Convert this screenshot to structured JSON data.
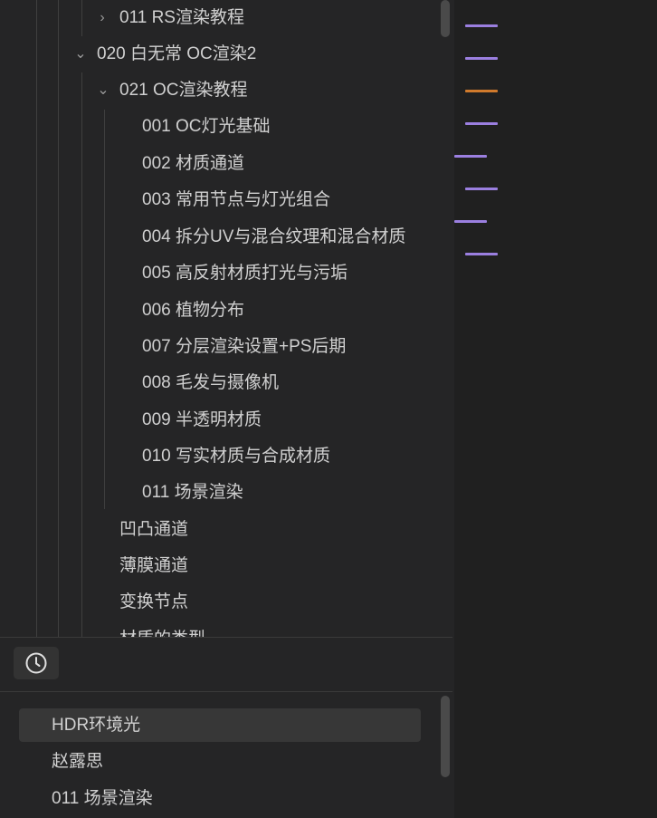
{
  "tree": [
    {
      "label": "011  RS渲染教程",
      "chevron": "›"
    },
    {
      "label": "020 白无常 OC渲染2",
      "chevron": "⌄"
    },
    {
      "label": "021 OC渲染教程",
      "chevron": "⌄"
    },
    {
      "label": "001 OC灯光基础"
    },
    {
      "label": "002 材质通道"
    },
    {
      "label": "003 常用节点与灯光组合"
    },
    {
      "label": "004 拆分UV与混合纹理和混合材质"
    },
    {
      "label": "005 高反射材质打光与污垢"
    },
    {
      "label": "006 植物分布"
    },
    {
      "label": "007 分层渲染设置+PS后期"
    },
    {
      "label": "008 毛发与摄像机"
    },
    {
      "label": "009 半透明材质"
    },
    {
      "label": "010 写实材质与合成材质"
    },
    {
      "label": "011 场景渲染"
    },
    {
      "label": "凹凸通道"
    },
    {
      "label": "薄膜通道"
    },
    {
      "label": "变换节点"
    },
    {
      "label": "材质的类型"
    }
  ],
  "history": {
    "icon": "clock-icon"
  },
  "recent": [
    {
      "label": "HDR环境光"
    },
    {
      "label": "赵露思"
    },
    {
      "label": "011 场景渲染"
    }
  ],
  "colors": {
    "purple_mark": "#9b7fe0",
    "orange_mark": "#d07a2c"
  }
}
